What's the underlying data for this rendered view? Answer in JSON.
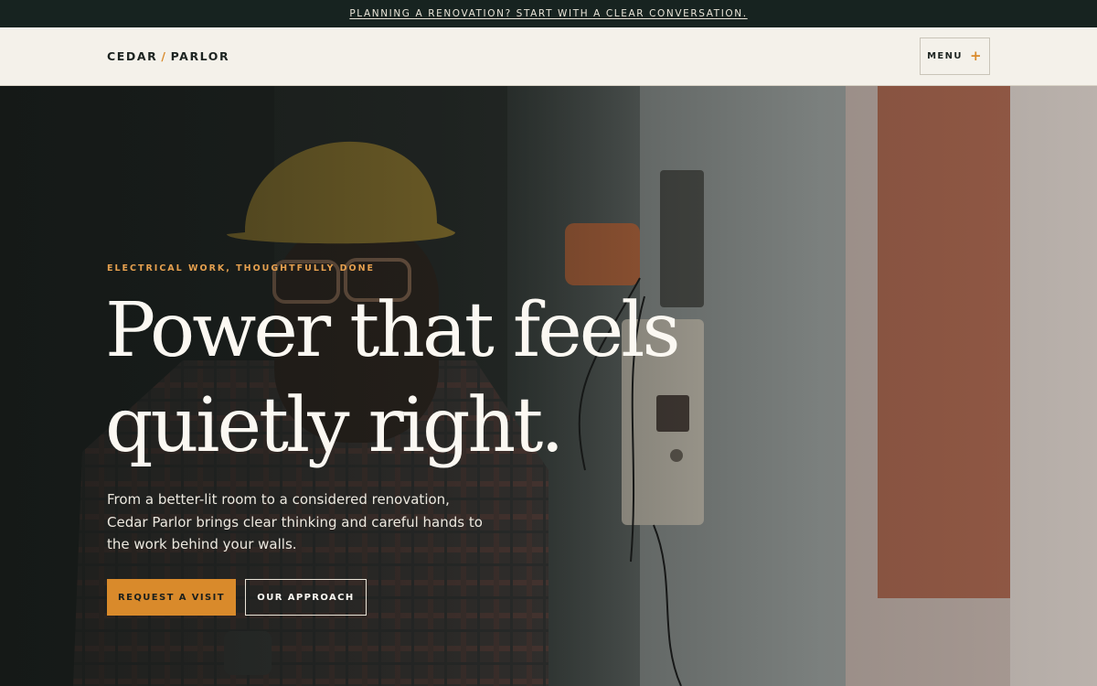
{
  "announcement": {
    "text": "PLANNING A RENOVATION? START WITH A CLEAR CONVERSATION."
  },
  "header": {
    "logo_left": "CEDAR",
    "logo_sep": "/",
    "logo_right": "PARLOR",
    "menu_label": "MENU",
    "menu_icon": "plus-icon"
  },
  "hero": {
    "eyebrow": "ELECTRICAL WORK, THOUGHTFULLY DONE",
    "headline_line1": "Power that feels",
    "headline_line2": "quietly right.",
    "lede": "From a better-lit room to a considered renovation, Cedar Parlor brings clear thinking and careful hands to the work behind your walls.",
    "cta_primary": "REQUEST A VISIT",
    "cta_secondary": "OUR APPROACH",
    "image_subject": "electrician in hard hat beside wall-mounted electrical box"
  },
  "colors": {
    "accent": "#d98a2b",
    "topbar": "#172320",
    "header_bg": "#f4f1ea",
    "headline": "#fbf8f2"
  }
}
